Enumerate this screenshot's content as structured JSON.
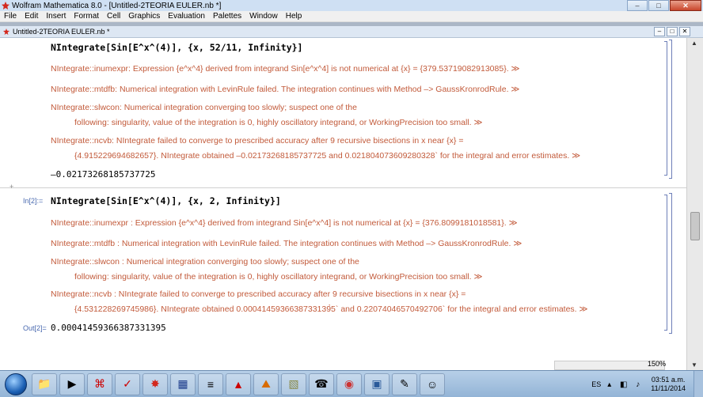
{
  "window": {
    "title": "Wolfram Mathematica 8.0 - [Untitled-2TEORIA EULER.nb *]",
    "minimize": "–",
    "maximize": "□",
    "close": "✕"
  },
  "menu": [
    "File",
    "Edit",
    "Insert",
    "Format",
    "Cell",
    "Graphics",
    "Evaluation",
    "Palettes",
    "Window",
    "Help"
  ],
  "document": {
    "title": "Untitled-2TEORIA EULER.nb *"
  },
  "cells": {
    "first": {
      "input": "NIntegrate[Sin[E^x^(4)], {x, 52/11, Infinity}]",
      "msg1": "NIntegrate::inumexpr: Expression {e^x^4} derived from integrand Sin[e^x^4] is not numerical at {x} = {379.53719082913085}. ≫",
      "msg2": "NIntegrate::mtdfb: Numerical integration with LevinRule failed. The integration continues with Method –> GaussKronrodRule. ≫",
      "msg3a": "NIntegrate::slwcon: Numerical integration converging too slowly; suspect one of the",
      "msg3b": "following: singularity, value of the integration is 0, highly oscillatory integrand, or WorkingPrecision too small. ≫",
      "msg4a": "NIntegrate::ncvb: NIntegrate failed to converge to prescribed accuracy after 9 recursive bisections in x near {x} =",
      "msg4b": "{4.915229694682657}. NIntegrate obtained –0.02173268185737725 and 0.021804073609280328` for the integral and error estimates. ≫",
      "output": "–0.02173268185737725"
    },
    "second": {
      "in_label": "In[2]:=",
      "input": "NIntegrate[Sin[E^x^(4)], {x, 2, Infinity}]",
      "msg1": "NIntegrate::inumexpr : Expression {e^x^4} derived from integrand Sin[e^x^4] is not numerical at {x} = {376.8099181018581}. ≫",
      "msg2": "NIntegrate::mtdfb : Numerical integration with LevinRule failed. The integration continues with Method –> GaussKronrodRule. ≫",
      "msg3a": "NIntegrate::slwcon : Numerical integration converging too slowly; suspect one of the",
      "msg3b": "following: singularity, value of the integration is 0, highly oscillatory integrand, or WorkingPrecision too small. ≫",
      "msg4a": "NIntegrate::ncvb : NIntegrate failed to converge to prescribed accuracy after 9 recursive bisections in x near {x} =",
      "msg4b": "{4.531228269745986}. NIntegrate obtained 0.0004145936638733139̀5` and 0.22074046570492706` for the integral and error estimates. ≫",
      "out_label": "Out[2]=",
      "output": "0.00041459366387331395"
    }
  },
  "status": {
    "zoom": "150%"
  },
  "taskbar": {
    "language": "ES",
    "time": "03:51 a.m.",
    "date": "11/11/2014"
  },
  "icons": [
    "start-orb",
    "folder-icon",
    "media-icon",
    "acrobat-icon",
    "mathematica-icon",
    "star-icon",
    "calendar-icon",
    "document-icon",
    "cone-icon",
    "matlab-icon",
    "image-icon",
    "phone-icon",
    "firefox-icon",
    "window-icon",
    "brush-icon",
    "game-icon"
  ],
  "colors": {
    "message": "#c25a3a",
    "cell_label": "#4a6ab0",
    "bracket": "#6d7fb8"
  }
}
